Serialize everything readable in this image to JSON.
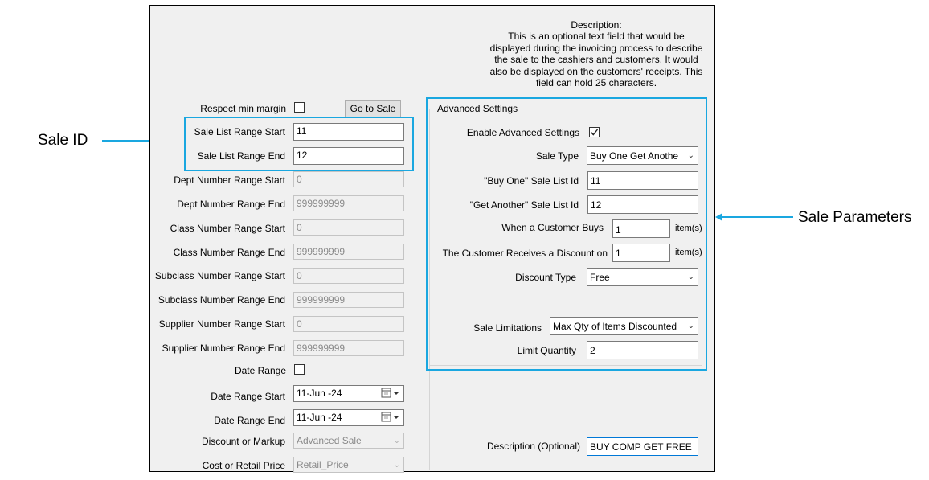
{
  "colors": {
    "highlight": "#1aa7e0",
    "window_bg": "#f0f0f0"
  },
  "annotations": {
    "sale_id": "Sale ID",
    "sale_parameters": "Sale Parameters"
  },
  "description_help": [
    "Description:",
    "This is an optional text field that would be",
    "displayed during the invoicing process to describe",
    "the sale to the cashiers and customers. It would",
    "also be displayed on the customers' receipts. This",
    "field can hold 25 characters."
  ],
  "left_panel": {
    "respect_min_margin_label": "Respect min margin",
    "go_to_sale_button": "Go to Sale",
    "sale_list_range_start": {
      "label": "Sale List Range Start",
      "value": "11"
    },
    "sale_list_range_end": {
      "label": "Sale List Range End",
      "value": "12"
    },
    "dept_number_range_start": {
      "label": "Dept Number Range Start",
      "value": "0"
    },
    "dept_number_range_end": {
      "label": "Dept Number Range End",
      "value": "999999999"
    },
    "class_number_range_start": {
      "label": "Class Number Range Start",
      "value": "0"
    },
    "class_number_range_end": {
      "label": "Class Number Range End",
      "value": "999999999"
    },
    "subclass_number_range_start": {
      "label": "Subclass Number Range Start",
      "value": "0"
    },
    "subclass_number_range_end": {
      "label": "Subclass Number Range End",
      "value": "999999999"
    },
    "supplier_number_range_start": {
      "label": "Supplier Number Range Start",
      "value": "0"
    },
    "supplier_number_range_end": {
      "label": "Supplier Number Range End",
      "value": "999999999"
    },
    "date_range_label": "Date Range",
    "date_range_start": {
      "label": "Date Range Start",
      "value": "11-Jun -24"
    },
    "date_range_end": {
      "label": "Date Range End",
      "value": "11-Jun -24"
    },
    "discount_or_markup": {
      "label": "Discount or Markup",
      "value": "Advanced Sale"
    },
    "cost_or_retail_price": {
      "label": "Cost or Retail Price",
      "value": "Retail_Price"
    }
  },
  "advanced_settings": {
    "title": "Advanced Settings",
    "enable_label": "Enable Advanced Settings",
    "enable_checked": true,
    "sale_type": {
      "label": "Sale Type",
      "value": "Buy One Get Anothe"
    },
    "buy_one_sale_list_id": {
      "label": "\"Buy One\" Sale List Id",
      "value": "11"
    },
    "get_another_sale_list_id": {
      "label": "\"Get Another\" Sale List Id",
      "value": "12"
    },
    "when_customer_buys": {
      "label": "When a Customer Buys",
      "value": "1",
      "unit": "item(s)"
    },
    "customer_receives_discount_on": {
      "label": "The Customer Receives a Discount on",
      "value": "1",
      "unit": "item(s)"
    },
    "discount_type": {
      "label": "Discount Type",
      "value": "Free"
    },
    "sale_limitations": {
      "label": "Sale Limitations",
      "value": "Max Qty of Items Discounted"
    },
    "limit_quantity": {
      "label": "Limit Quantity",
      "value": "2"
    }
  },
  "description_field": {
    "label": "Description (Optional)",
    "value": "BUY COMP GET FREE"
  }
}
